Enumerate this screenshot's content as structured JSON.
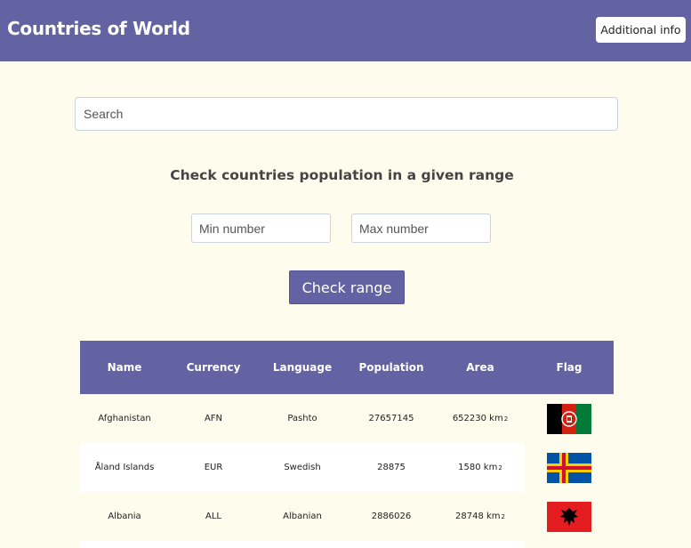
{
  "header": {
    "title": "Countries of World",
    "info_button": "Additional info"
  },
  "search": {
    "placeholder": "Search"
  },
  "range": {
    "heading": "Check countries population in a given range",
    "min_placeholder": "Min number",
    "max_placeholder": "Max number",
    "button_label": "Check range"
  },
  "table": {
    "columns": [
      "Name",
      "Currency",
      "Language",
      "Population",
      "Area",
      "Flag"
    ],
    "rows": [
      {
        "name": "Afghanistan",
        "currency": "AFN",
        "language": "Pashto",
        "population": "27657145",
        "area": "652230 km",
        "area_sup": "2",
        "flag": "afghanistan-flag-icon"
      },
      {
        "name": "Åland Islands",
        "currency": "EUR",
        "language": "Swedish",
        "population": "28875",
        "area": "1580 km",
        "area_sup": "2",
        "flag": "aland-islands-flag-icon"
      },
      {
        "name": "Albania",
        "currency": "ALL",
        "language": "Albanian",
        "population": "2886026",
        "area": "28748 km",
        "area_sup": "2",
        "flag": "albania-flag-icon"
      }
    ]
  },
  "colors": {
    "primary": "#6363a3",
    "background": "#fefcec",
    "white": "#ffffff"
  }
}
